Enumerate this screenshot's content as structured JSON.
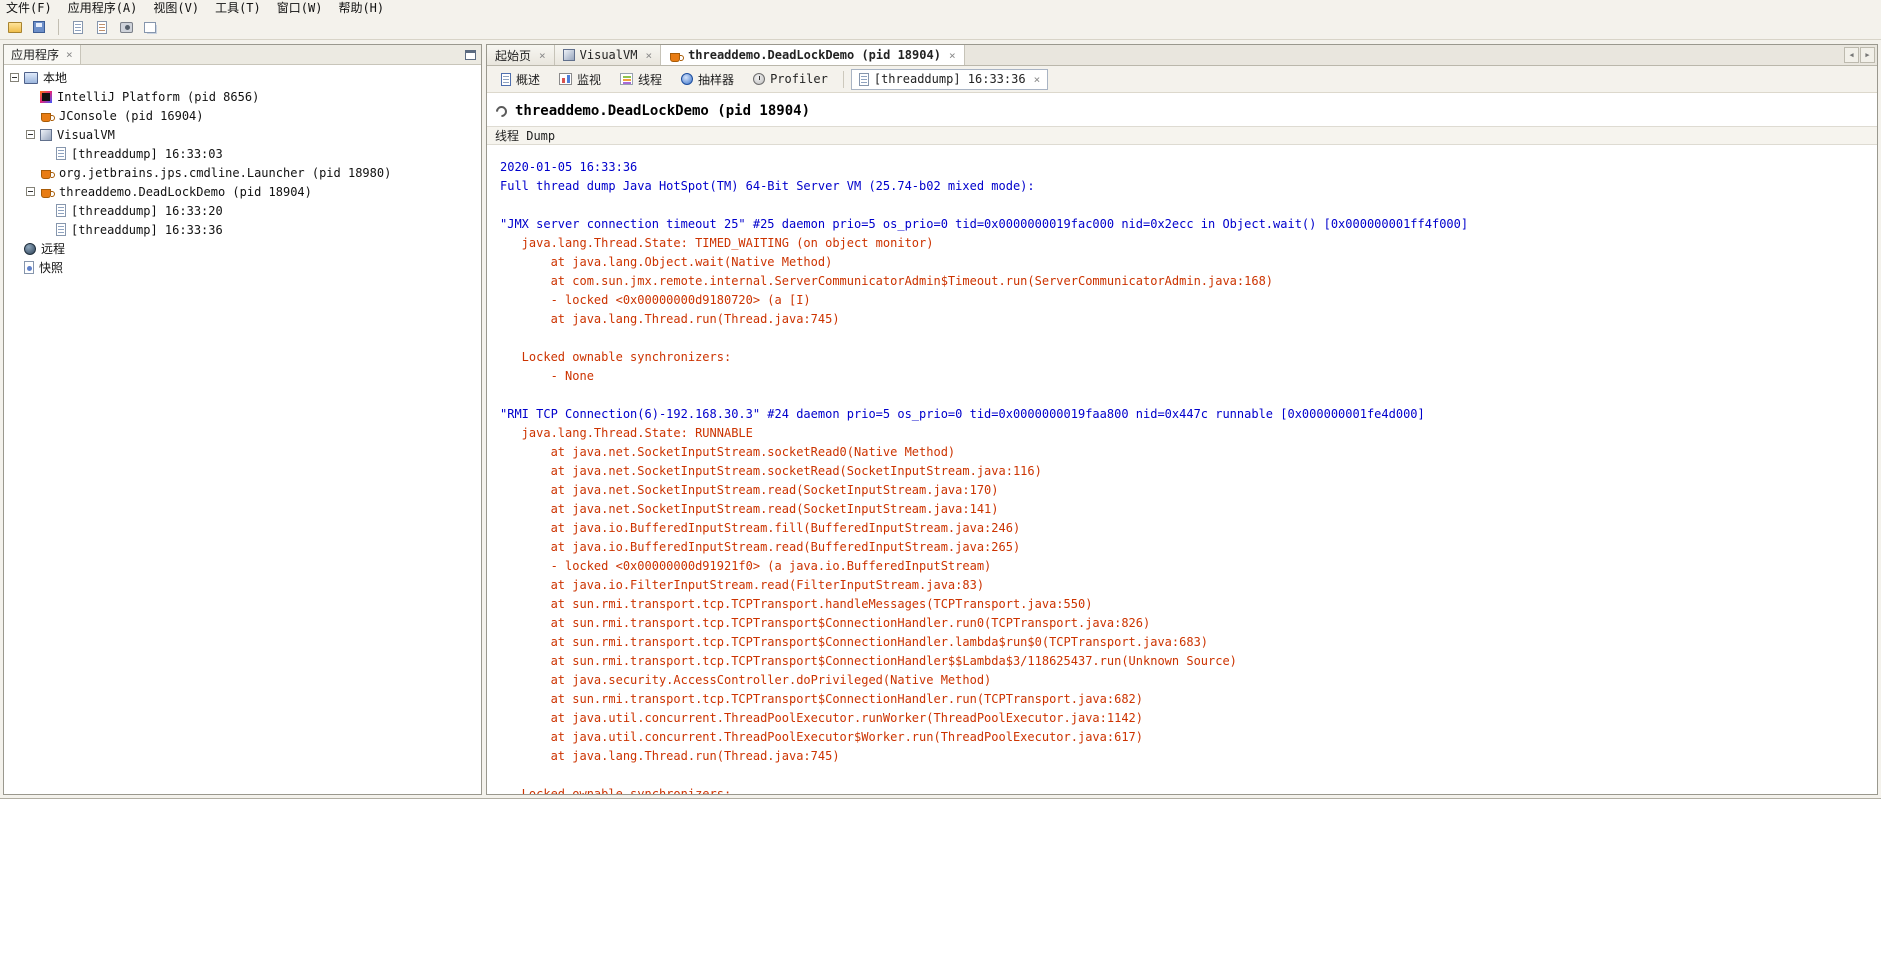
{
  "colors": {
    "dump_header_blue": "#0000cc",
    "dump_stack_red": "#cc3300"
  },
  "ui": {
    "close_glyph": "×",
    "tab_scroll_left": "◀",
    "tab_scroll_right": "▶"
  },
  "menubar": {
    "items": [
      "文件(F)",
      "应用程序(A)",
      "视图(V)",
      "工具(T)",
      "窗口(W)",
      "帮助(H)"
    ]
  },
  "toolbar": {
    "items": [
      "open-snapshot-icon",
      "save-snapshot-icon",
      "separator",
      "take-thread-dump-icon",
      "take-heap-dump-icon",
      "take-snapshot-icon",
      "compare-snapshots-icon"
    ]
  },
  "sidebar": {
    "title": "应用程序",
    "tree": [
      {
        "level": 0,
        "expander": true,
        "icon": "computer-icon",
        "label": "本地"
      },
      {
        "level": 1,
        "expander": false,
        "icon": "intellij-icon",
        "label": "IntelliJ Platform (pid 8656)"
      },
      {
        "level": 1,
        "expander": false,
        "icon": "java-icon",
        "label": "JConsole (pid 16904)"
      },
      {
        "level": 1,
        "expander": true,
        "icon": "visualvm-icon",
        "label": "VisualVM"
      },
      {
        "level": 2,
        "expander": false,
        "icon": "threaddump-icon",
        "label": "[threaddump] 16:33:03"
      },
      {
        "level": 1,
        "expander": false,
        "icon": "java-icon",
        "label": "org.jetbrains.jps.cmdline.Launcher (pid 18980)"
      },
      {
        "level": 1,
        "expander": true,
        "icon": "java-icon",
        "label": "threaddemo.DeadLockDemo (pid 18904)"
      },
      {
        "level": 2,
        "expander": false,
        "icon": "threaddump-icon",
        "label": "[threaddump] 16:33:20"
      },
      {
        "level": 2,
        "expander": false,
        "icon": "threaddump-icon",
        "label": "[threaddump] 16:33:36"
      },
      {
        "level": 0,
        "expander": false,
        "icon": "remote-icon",
        "label": "远程"
      },
      {
        "level": 0,
        "expander": false,
        "icon": "snapshots-icon",
        "label": "快照"
      }
    ]
  },
  "doc_tabs": [
    {
      "label": "起始页",
      "icon": null,
      "active": false
    },
    {
      "label": "VisualVM",
      "icon": "visualvm-icon",
      "active": false
    },
    {
      "label": "threaddemo.DeadLockDemo (pid 18904)",
      "icon": "java-icon",
      "active": true
    }
  ],
  "view_tabs": [
    {
      "label": "概述",
      "icon": "overview-icon",
      "active": false,
      "closable": false,
      "separator_before": false
    },
    {
      "label": "监视",
      "icon": "monitor-icon",
      "active": false,
      "closable": false,
      "separator_before": false
    },
    {
      "label": "线程",
      "icon": "threads-icon",
      "active": false,
      "closable": false,
      "separator_before": false
    },
    {
      "label": "抽样器",
      "icon": "sampler-icon",
      "active": false,
      "closable": false,
      "separator_before": false
    },
    {
      "label": "Profiler",
      "icon": "profiler-icon",
      "active": false,
      "closable": false,
      "separator_before": false
    },
    {
      "label": "[threaddump] 16:33:36",
      "icon": "threaddump-icon",
      "active": true,
      "closable": true,
      "separator_before": true
    }
  ],
  "content": {
    "heading": "threaddemo.DeadLockDemo (pid 18904)",
    "section_title": "线程 Dump",
    "dump": [
      {
        "c": "b",
        "t": "2020-01-05 16:33:36"
      },
      {
        "c": "b",
        "t": "Full thread dump Java HotSpot(TM) 64-Bit Server VM (25.74-b02 mixed mode):"
      },
      {
        "c": "",
        "t": ""
      },
      {
        "c": "b",
        "t": "\"JMX server connection timeout 25\" #25 daemon prio=5 os_prio=0 tid=0x0000000019fac000 nid=0x2ecc in Object.wait() [0x000000001ff4f000]"
      },
      {
        "c": "r",
        "t": "   java.lang.Thread.State: TIMED_WAITING (on object monitor)"
      },
      {
        "c": "r",
        "t": "       at java.lang.Object.wait(Native Method)"
      },
      {
        "c": "r",
        "t": "       at com.sun.jmx.remote.internal.ServerCommunicatorAdmin$Timeout.run(ServerCommunicatorAdmin.java:168)"
      },
      {
        "c": "r",
        "t": "       - locked <0x00000000d9180720> (a [I)"
      },
      {
        "c": "r",
        "t": "       at java.lang.Thread.run(Thread.java:745)"
      },
      {
        "c": "",
        "t": ""
      },
      {
        "c": "r",
        "t": "   Locked ownable synchronizers:"
      },
      {
        "c": "r",
        "t": "       - None"
      },
      {
        "c": "",
        "t": ""
      },
      {
        "c": "b",
        "t": "\"RMI TCP Connection(6)-192.168.30.3\" #24 daemon prio=5 os_prio=0 tid=0x0000000019faa800 nid=0x447c runnable [0x000000001fe4d000]"
      },
      {
        "c": "r",
        "t": "   java.lang.Thread.State: RUNNABLE"
      },
      {
        "c": "r",
        "t": "       at java.net.SocketInputStream.socketRead0(Native Method)"
      },
      {
        "c": "r",
        "t": "       at java.net.SocketInputStream.socketRead(SocketInputStream.java:116)"
      },
      {
        "c": "r",
        "t": "       at java.net.SocketInputStream.read(SocketInputStream.java:170)"
      },
      {
        "c": "r",
        "t": "       at java.net.SocketInputStream.read(SocketInputStream.java:141)"
      },
      {
        "c": "r",
        "t": "       at java.io.BufferedInputStream.fill(BufferedInputStream.java:246)"
      },
      {
        "c": "r",
        "t": "       at java.io.BufferedInputStream.read(BufferedInputStream.java:265)"
      },
      {
        "c": "r",
        "t": "       - locked <0x00000000d91921f0> (a java.io.BufferedInputStream)"
      },
      {
        "c": "r",
        "t": "       at java.io.FilterInputStream.read(FilterInputStream.java:83)"
      },
      {
        "c": "r",
        "t": "       at sun.rmi.transport.tcp.TCPTransport.handleMessages(TCPTransport.java:550)"
      },
      {
        "c": "r",
        "t": "       at sun.rmi.transport.tcp.TCPTransport$ConnectionHandler.run0(TCPTransport.java:826)"
      },
      {
        "c": "r",
        "t": "       at sun.rmi.transport.tcp.TCPTransport$ConnectionHandler.lambda$run$0(TCPTransport.java:683)"
      },
      {
        "c": "r",
        "t": "       at sun.rmi.transport.tcp.TCPTransport$ConnectionHandler$$Lambda$3/118625437.run(Unknown Source)"
      },
      {
        "c": "r",
        "t": "       at java.security.AccessController.doPrivileged(Native Method)"
      },
      {
        "c": "r",
        "t": "       at sun.rmi.transport.tcp.TCPTransport$ConnectionHandler.run(TCPTransport.java:682)"
      },
      {
        "c": "r",
        "t": "       at java.util.concurrent.ThreadPoolExecutor.runWorker(ThreadPoolExecutor.java:1142)"
      },
      {
        "c": "r",
        "t": "       at java.util.concurrent.ThreadPoolExecutor$Worker.run(ThreadPoolExecutor.java:617)"
      },
      {
        "c": "r",
        "t": "       at java.lang.Thread.run(Thread.java:745)"
      },
      {
        "c": "",
        "t": ""
      },
      {
        "c": "r",
        "t": "   Locked ownable synchronizers:"
      }
    ]
  }
}
